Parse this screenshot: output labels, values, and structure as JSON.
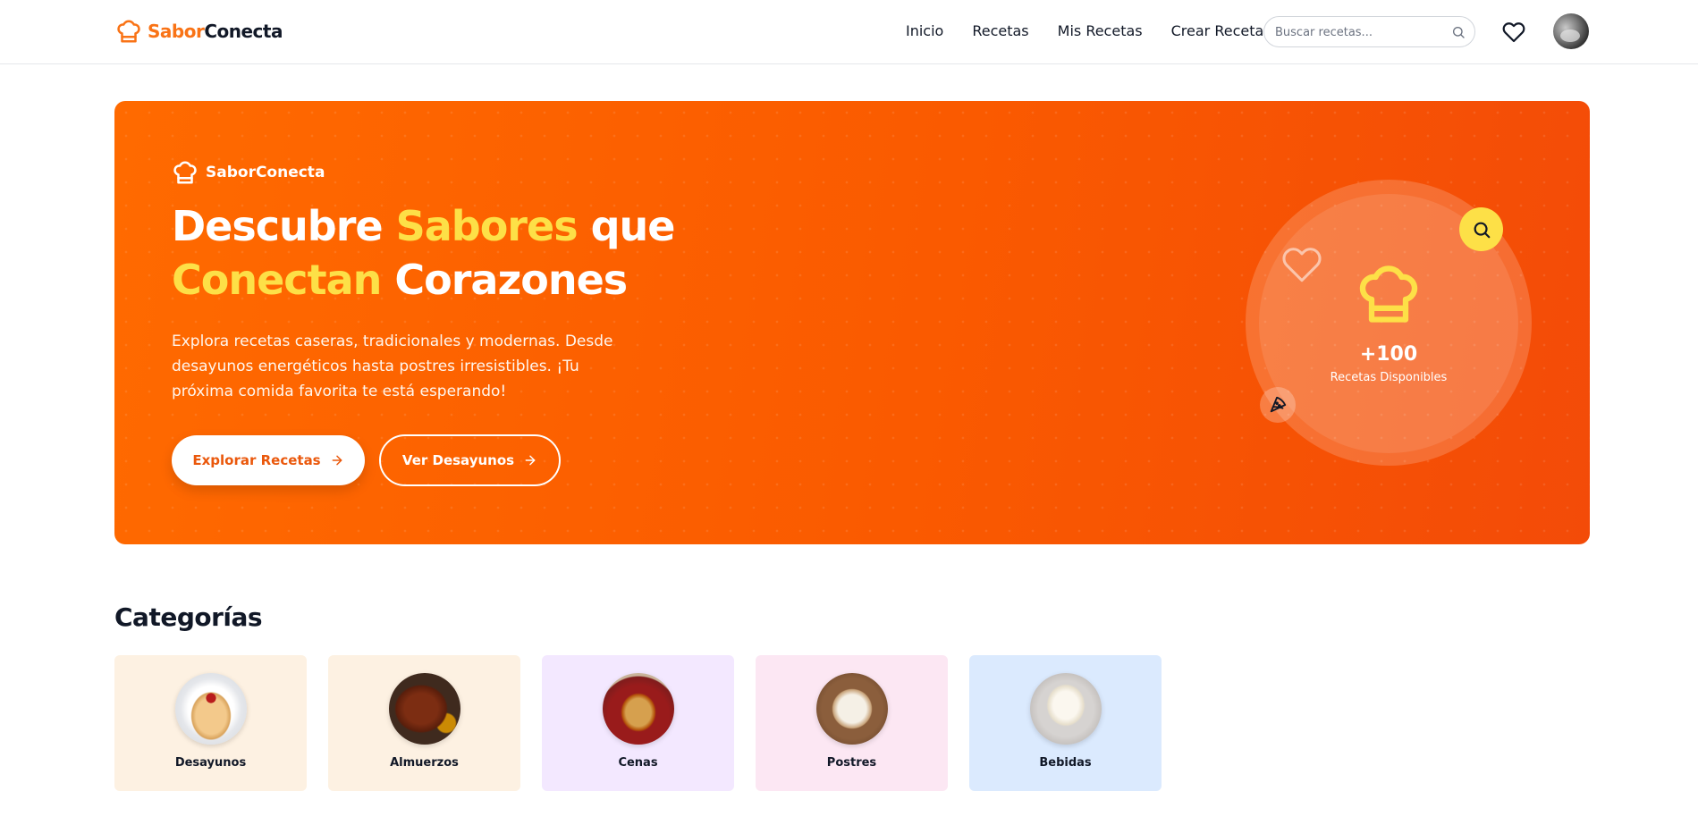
{
  "brand": {
    "part1": "Sabor",
    "part2": "Conecta",
    "full": "SaborConecta"
  },
  "nav": {
    "links": [
      "Inicio",
      "Recetas",
      "Mis Recetas",
      "Crear Receta"
    ],
    "search_placeholder": "Buscar recetas..."
  },
  "hero": {
    "title_parts": [
      "Descubre ",
      "Sabores",
      " que",
      "Conectan",
      " Corazones"
    ],
    "description": "Explora recetas caseras, tradicionales y modernas. Desde desayunos energéticos hasta postres irresistibles. ¡Tu próxima comida favorita te está esperando!",
    "primary_button": "Explorar Recetas",
    "secondary_button": "Ver Desayunos",
    "stat_value": "+100",
    "stat_label": "Recetas Disponibles"
  },
  "categories": {
    "heading": "Categorías",
    "items": [
      {
        "label": "Desayunos",
        "bg": "#fdf1e2"
      },
      {
        "label": "Almuerzos",
        "bg": "#fdf1e2"
      },
      {
        "label": "Cenas",
        "bg": "#f3e8ff"
      },
      {
        "label": "Postres",
        "bg": "#fce7f3"
      },
      {
        "label": "Bebidas",
        "bg": "#dbeafe"
      }
    ]
  },
  "colors": {
    "accent": "#f97316",
    "hero_gradient_start": "#ff6a00",
    "hero_gradient_end": "#f34b08",
    "highlight": "#fde047"
  },
  "icons": [
    "chef-hat-icon",
    "search-icon",
    "heart-icon",
    "arrow-right-icon",
    "pizza-icon"
  ]
}
